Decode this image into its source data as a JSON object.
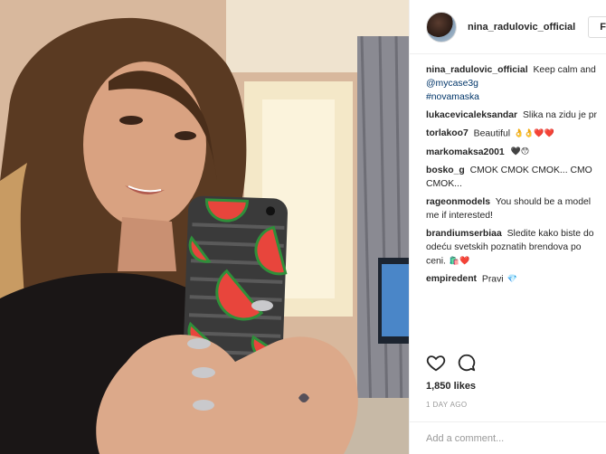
{
  "post": {
    "username": "nina_radulovic_official",
    "follow_label": "Fol",
    "caption": {
      "user": "nina_radulovic_official",
      "text": "Keep calm and",
      "mention": "@mycase3g",
      "hashtag": "#novamaska"
    },
    "comments": [
      {
        "user": "lukacevicaleksandar",
        "text": "Slika na zidu je pr",
        "emojis": ""
      },
      {
        "user": "torlakoo7",
        "text": "Beautiful",
        "emojis": "👌👌❤️❤️"
      },
      {
        "user": "markomaksa2001",
        "text": "",
        "emojis": "🖤😯"
      },
      {
        "user": "bosko_g",
        "text": "CMOK CMOK CMOK... CMO",
        "text2": "CMOK...",
        "emojis": ""
      },
      {
        "user": "rageonmodels",
        "text": "You should be a model",
        "text2": "me if interested!",
        "emojis": ""
      },
      {
        "user": "brandiumserbiaa",
        "text": "Sledite kako biste do",
        "text2": "odeću svetskih poznatih brendova po",
        "text3": "ceni.",
        "emojis": "🛍️❤️"
      },
      {
        "user": "empiredent",
        "text": "Pravi",
        "emojis": "💎"
      }
    ],
    "likes": "1,850 likes",
    "time_ago": "1 DAY AGO",
    "add_comment_placeholder": "Add a comment..."
  },
  "colors": {
    "link": "#003569",
    "phone_case": "#3a3a3a",
    "watermelon": "#e8453c"
  },
  "icons": [
    "heart-icon",
    "comment-icon"
  ]
}
